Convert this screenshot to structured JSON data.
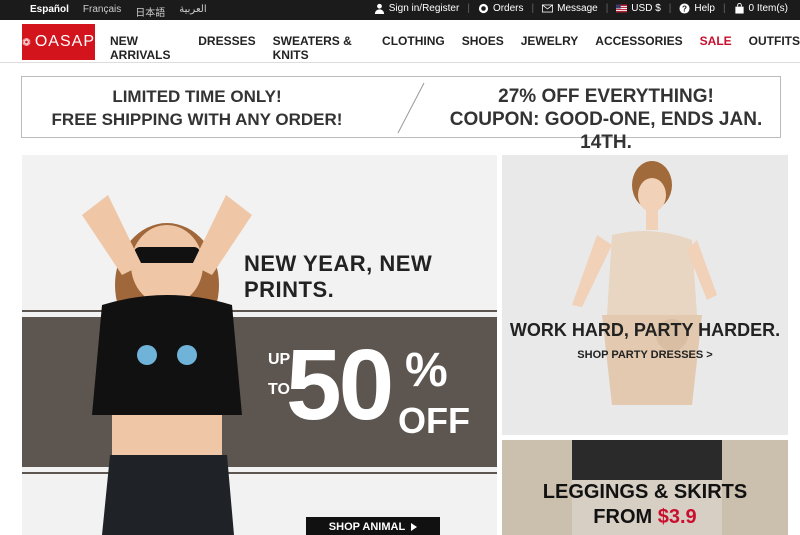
{
  "topbar": {
    "languages": [
      "Español",
      "Français",
      "日本語",
      "العربية"
    ],
    "active_language": "Español",
    "signin": "Sign in/Register",
    "orders": "Orders",
    "message": "Message",
    "currency": "USD $",
    "help": "Help",
    "cart": "0 Item(s)"
  },
  "brand": {
    "logo_text": "OASAP",
    "color": "#d4141c"
  },
  "nav": {
    "items": [
      "NEW ARRIVALS",
      "DRESSES",
      "SWEATERS & KNITS",
      "CLOTHING",
      "SHOES",
      "JEWELRY",
      "ACCESSORIES",
      "SALE",
      "OUTFITS"
    ],
    "sale_color": "#c8102e"
  },
  "promo": {
    "left_line1": "LIMITED TIME ONLY!",
    "left_line2": "FREE SHIPPING WITH ANY ORDER!",
    "right_line1": "27% OFF EVERYTHING!",
    "right_line2": "COUPON: GOOD-ONE, ENDS JAN. 14TH."
  },
  "hero": {
    "headline": "NEW YEAR, NEW PRINTS.",
    "up": "UP",
    "to": "TO",
    "discount": "50",
    "percent": "%",
    "off": "OFF",
    "button": "SHOP ANIMAL"
  },
  "tile_party": {
    "title": "WORK HARD, PARTY HARDER.",
    "link": "SHOP PARTY DRESSES >"
  },
  "tile_leggings": {
    "title": "LEGGINGS & SKIRTS",
    "from": "FROM",
    "price": "$3.9"
  }
}
